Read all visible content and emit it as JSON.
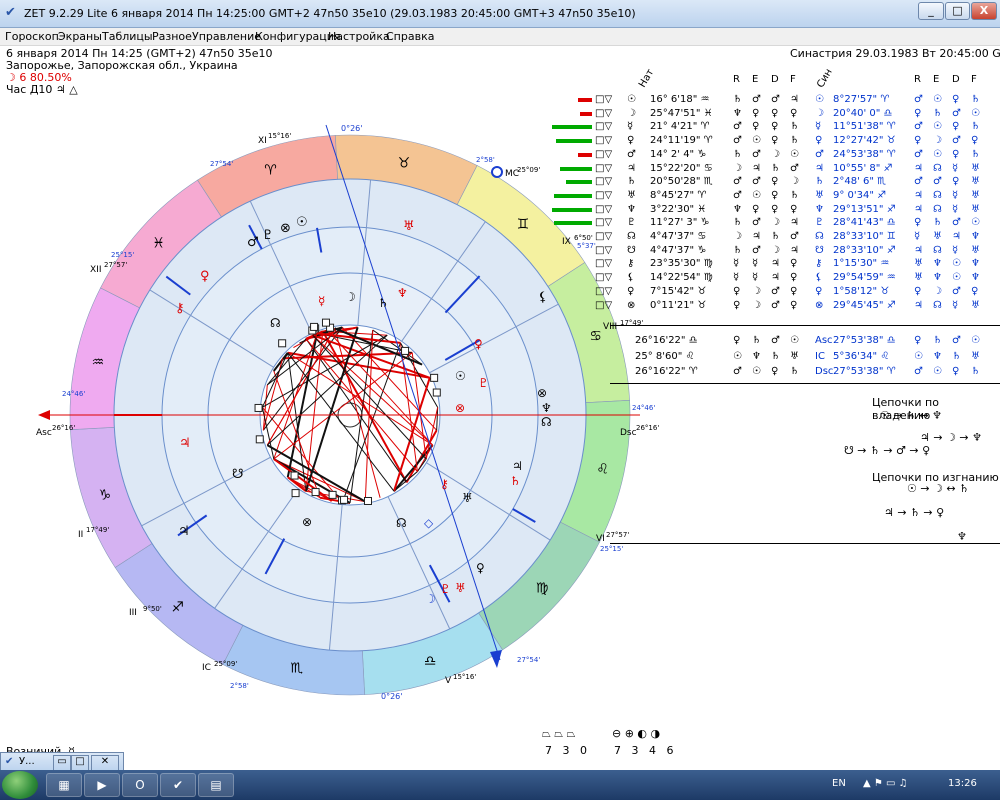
{
  "window": {
    "title": "ZET 9.2.29 Lite     6 января 2014   Пн   14:25:00 GMT+2 47n50  35e10   (29.03.1983  20:45:00 GMT+3 47n50 35e10)",
    "min_label": "_",
    "max_label": "□",
    "close_label": "X"
  },
  "menu": [
    "Гороскоп",
    "Экраны",
    "Таблицы",
    "Разное",
    "Управление",
    "Конфигурация",
    "Настройка",
    "Справка"
  ],
  "header": {
    "line1": "6 января 2014   Пн   14:25 (GMT+2) 47n50  35e10",
    "line2": "Запорожье, Запорожская обл., Украина",
    "line3": "☽  6 80.50%",
    "line4": "Час Д10  ♃  △",
    "synastry": "Синастрия 29.03.1983  Вт 20:45:00 GMT+3"
  },
  "chart_labels": {
    "mc_top": "0°26'",
    "ic_bottom": "0°26'",
    "xi": "XI",
    "xi_deg": "15°16'",
    "xii": "XII",
    "xii_deg": "27°57'",
    "asc": "Asc",
    "asc_deg": "26°16'",
    "dsc": "Dsc",
    "dsc_deg": "26°16'",
    "ii": "II",
    "ii_deg": "17°49'",
    "iii": "III",
    "iii_deg": "9°50'",
    "ic": "IC",
    "ic_deg": "25°09'",
    "v": "V",
    "v_deg": "15°16'",
    "vi": "VI",
    "vi_deg": "27°57'",
    "viii": "VIII",
    "viii_deg": "17°49'",
    "ix": "IX",
    "ix_deg": "6°50'",
    "mc": "MC",
    "mc_deg": "25°09'",
    "deg_2754_a": "27°54'",
    "deg_2754_b": "27°54'",
    "deg_2515_a": "25°15'",
    "deg_2515_b": "25°15'",
    "deg_2446_a": "24°46'",
    "deg_2446_b": "24°46'",
    "deg_258_a": "2°58'",
    "deg_258_b": "2°58'",
    "deg_537": "5°37'"
  },
  "zodiac": [
    "♈",
    "♉",
    "♊",
    "♋",
    "♌",
    "♍",
    "♎",
    "♏",
    "♐",
    "♑",
    "♒",
    "♓"
  ],
  "zodiac_colors": [
    "#f7a9a0",
    "#f4c493",
    "#f4f1a0",
    "#c6ee9f",
    "#a8e8a3",
    "#9cd6b6",
    "#a6dfef",
    "#a6c6f2",
    "#b6b8f3",
    "#d5b2f2",
    "#efaaf0",
    "#f6aad2"
  ],
  "table": {
    "headers_left": [
      "Нат",
      "R",
      "E",
      "D",
      "F"
    ],
    "headers_right": [
      "Син",
      "R",
      "E",
      "D",
      "F"
    ],
    "rows": [
      {
        "pos": "16° 6'18\" ♒",
        "r": "♄",
        "e": "♂",
        "d": "♂",
        "f": "♃",
        "pl2": "☉",
        "pos2": "8°27'57\" ♈",
        "r2": "♂",
        "e2": "☉",
        "d2": "♀",
        "f2": "♄"
      },
      {
        "pos": "25°47'51\" ♓",
        "r": "♆",
        "e": "♀",
        "d": "♀",
        "f": "♀",
        "pl2": "☽",
        "pos2": "20°40' 0\" ♎",
        "r2": "♀",
        "e2": "♄",
        "d2": "♂",
        "f2": "☉"
      },
      {
        "pos": "21° 4'21\" ♈",
        "r": "♂",
        "e": "♀",
        "d": "♀",
        "f": "♄",
        "pl2": "☿",
        "pos2": "11°51'38\" ♈",
        "r2": "♂",
        "e2": "☉",
        "d2": "♀",
        "f2": "♄"
      },
      {
        "pos": "24°11'19\" ♈",
        "r": "♂",
        "e": "☉",
        "d": "♀",
        "f": "♄",
        "pl2": "♀",
        "pos2": "12°27'42\" ♉",
        "r2": "♀",
        "e2": "☽",
        "d2": "♂",
        "f2": "♀"
      },
      {
        "pos": "14° 2' 4\" ♑",
        "r": "♄",
        "e": "♂",
        "d": "☽",
        "f": "☉",
        "pl2": "♂",
        "pos2": "24°53'38\" ♈",
        "r2": "♂",
        "e2": "☉",
        "d2": "♀",
        "f2": "♄"
      },
      {
        "pos": "15°22'20\" ♋",
        "r": "☽",
        "e": "♃",
        "d": "♄",
        "f": "♂",
        "pl2": "♃",
        "pos2": "10°55' 8\" ♐",
        "r2": "♃",
        "e2": "☊",
        "d2": "☿",
        "f2": "♅"
      },
      {
        "pos": "20°50'28\" ♏",
        "r": "♂",
        "e": "♂",
        "d": "♀",
        "f": "☽",
        "pl2": "♄",
        "pos2": "2°48' 6\" ♏",
        "r2": "♂",
        "e2": "♂",
        "d2": "♀",
        "f2": "♅"
      },
      {
        "pos": "8°45'27\" ♈",
        "r": "♂",
        "e": "☉",
        "d": "♀",
        "f": "♄",
        "pl2": "♅",
        "pos2": "9° 0'34\" ♐",
        "r2": "♃",
        "e2": "☊",
        "d2": "☿",
        "f2": "♅"
      },
      {
        "pos": "3°22'30\" ♓",
        "r": "♆",
        "e": "♀",
        "d": "♀",
        "f": "♀",
        "pl2": "♆",
        "pos2": "29°13'51\" ♐",
        "r2": "♃",
        "e2": "☊",
        "d2": "☿",
        "f2": "♅"
      },
      {
        "pos": "11°27' 3\" ♑",
        "r": "♄",
        "e": "♂",
        "d": "☽",
        "f": "♃",
        "pl2": "♇",
        "pos2": "28°41'43\" ♎",
        "r2": "♀",
        "e2": "♄",
        "d2": "♂",
        "f2": "☉"
      },
      {
        "pos": "4°47'37\" ♋",
        "r": "☽",
        "e": "♃",
        "d": "♄",
        "f": "♂",
        "pl2": "☊",
        "pos2": "28°33'10\" ♊",
        "r2": "☿",
        "e2": "♅",
        "d2": "♃",
        "f2": "♆"
      },
      {
        "pos": "4°47'37\" ♑",
        "r": "♄",
        "e": "♂",
        "d": "☽",
        "f": "♃",
        "pl2": "☋",
        "pos2": "28°33'10\" ♐",
        "r2": "♃",
        "e2": "☊",
        "d2": "☿",
        "f2": "♅"
      },
      {
        "pos": "23°35'30\" ♍",
        "r": "☿",
        "e": "☿",
        "d": "♃",
        "f": "♀",
        "pl2": "⚷",
        "pos2": "1°15'30\" ♒",
        "r2": "♅",
        "e2": "♆",
        "d2": "☉",
        "f2": "♆"
      },
      {
        "pos": "14°22'54\" ♍",
        "r": "☿",
        "e": "☿",
        "d": "♃",
        "f": "♀",
        "pl2": "⚸",
        "pos2": "29°54'59\" ♒",
        "r2": "♅",
        "e2": "♆",
        "d2": "☉",
        "f2": "♆"
      },
      {
        "pos": "7°15'42\" ♉",
        "r": "♀",
        "e": "☽",
        "d": "♂",
        "f": "♀",
        "pl2": "♀",
        "pos2": "1°58'12\" ♉",
        "r2": "♀",
        "e2": "☽",
        "d2": "♂",
        "f2": "♀"
      },
      {
        "pos": "0°11'21\" ♉",
        "r": "♀",
        "e": "☽",
        "d": "♂",
        "f": "♀",
        "pl2": "⊗",
        "pos2": "29°45'45\" ♐",
        "r2": "♃",
        "e2": "☊",
        "d2": "☿",
        "f2": "♅"
      }
    ],
    "angles": [
      {
        "pos": "26°16'22\" ♎",
        "r": "♀",
        "e": "♄",
        "d": "♂",
        "f": "☉",
        "pl2": "Asc",
        "pos2": "27°53'38\" ♎",
        "r2": "♀",
        "e2": "♄",
        "d2": "♂",
        "f2": "☉"
      },
      {
        "pos": "25° 8'60\" ♌",
        "r": "☉",
        "e": "♆",
        "d": "♄",
        "f": "♅",
        "pl2": "IC",
        "pos2": "5°36'34\" ♌",
        "r2": "☉",
        "e2": "♆",
        "d2": "♄",
        "f2": "♅"
      },
      {
        "pos": "26°16'22\" ♈",
        "r": "♂",
        "e": "☉",
        "d": "♀",
        "f": "♄",
        "pl2": "Dsc",
        "pos2": "27°53'38\" ♈",
        "r2": "♂",
        "e2": "☉",
        "d2": "♀",
        "f2": "♄"
      }
    ]
  },
  "chains": {
    "title1": "Цепочки по владению",
    "c1_l1": "☉ → ♄ ↔ ♆",
    "c1_l2": "♃ → ☽ → ♆",
    "c1_l3": "☋ → ♄ → ♂ → ♀",
    "title2": "Цепочки по изгнанию",
    "c2_l1": "☉ → ☽ ↔ ♄",
    "c2_l2": "♃ → ♄ → ♀",
    "c2_l3": "♆"
  },
  "bottom": {
    "label": "Возничий",
    "label_sym": "☿",
    "counts_a": [
      "7",
      "3",
      "0"
    ],
    "counts_b": [
      "7",
      "3",
      "4",
      "6"
    ]
  },
  "taskbar": {
    "minwin_title": "У...",
    "lang": "EN",
    "time": "13:26"
  }
}
